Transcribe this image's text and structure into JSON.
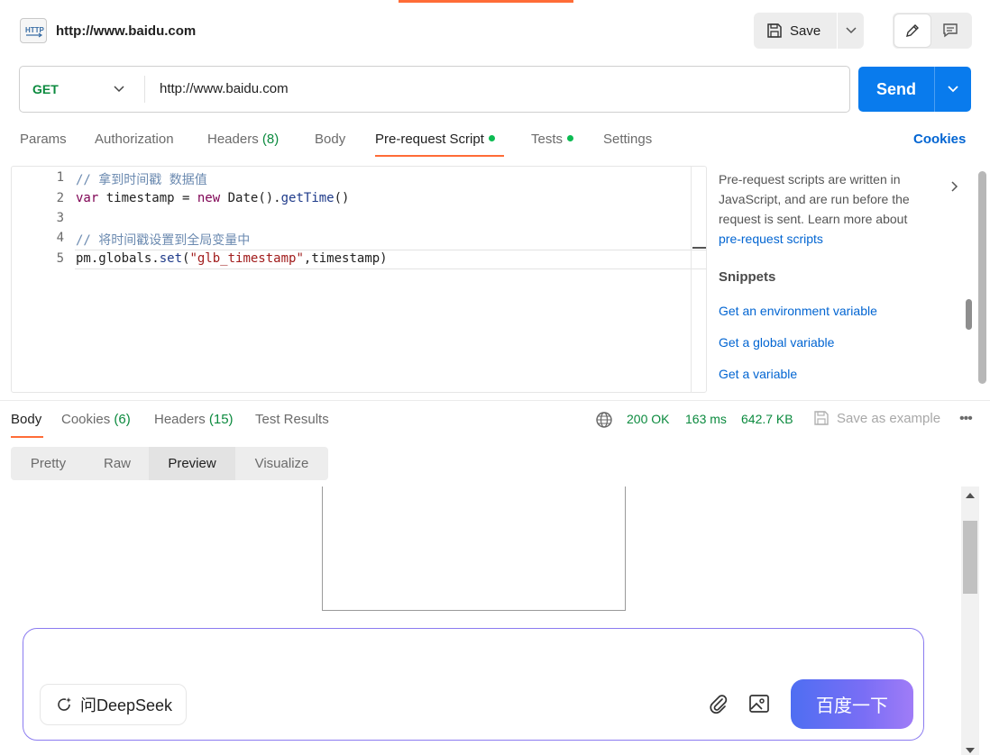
{
  "header": {
    "request_name": "http://www.baidu.com",
    "http_icon": "http-request-icon",
    "save_label": "Save"
  },
  "request": {
    "method": "GET",
    "url": "http://www.baidu.com",
    "send_label": "Send"
  },
  "request_tabs": {
    "params": "Params",
    "authorization": "Authorization",
    "headers": "Headers",
    "headers_count": "(8)",
    "body": "Body",
    "pre_request": "Pre-request Script",
    "tests": "Tests",
    "settings": "Settings",
    "active": "Pre-request Script",
    "cookies": "Cookies"
  },
  "editor": {
    "line_numbers": [
      "1",
      "2",
      "3",
      "4",
      "5"
    ],
    "lines": {
      "l1_comment": "// 拿到时间戳 数据值",
      "l2_var": "var",
      "l2_name": " timestamp = ",
      "l2_new": "new",
      "l2_date": " Date().",
      "l2_fn": "getTime",
      "l2_end": "()",
      "l4_comment": "// 将时间戳设置到全局变量中",
      "l5_prefix": "pm.globals.",
      "l5_fn": "set",
      "l5_open": "(",
      "l5_str": "\"glb_timestamp\"",
      "l5_rest": ",timestamp)"
    }
  },
  "side_panel": {
    "description": "Pre-request scripts are written in JavaScript, and are run before the request is sent. Learn more about",
    "link": "pre-request scripts",
    "snippets_title": "Snippets",
    "snippets": [
      "Get an environment variable",
      "Get a global variable",
      "Get a variable"
    ]
  },
  "response": {
    "tabs": {
      "body": "Body",
      "cookies": "Cookies",
      "cookies_count": "(6)",
      "headers": "Headers",
      "headers_count": "(15)",
      "test_results": "Test Results"
    },
    "status": "200 OK",
    "time": "163 ms",
    "size": "642.7 KB",
    "save_as_example": "Save as example",
    "view_modes": [
      "Pretty",
      "Raw",
      "Preview",
      "Visualize"
    ],
    "active_view": "Preview"
  },
  "preview": {
    "ask_label": "问DeepSeek",
    "search_button": "百度一下"
  },
  "colors": {
    "accent": "#ff6c37",
    "send": "#097bed",
    "method": "#0b8a3e",
    "link": "#0265d2",
    "status_ok": "#0b8a3e"
  }
}
